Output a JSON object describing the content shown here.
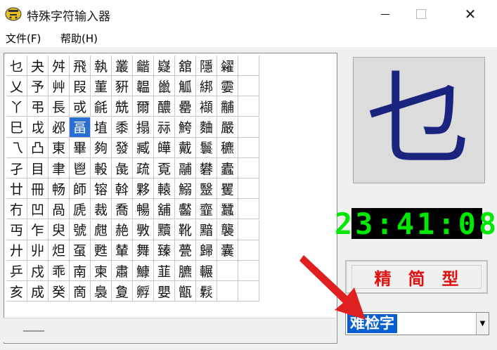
{
  "window": {
    "title": "特殊字符输入器",
    "icon": "app-icon",
    "minimize": "minimize-icon",
    "maximize": "maximize-icon",
    "close_glyph": "✕"
  },
  "menu": [
    "文件(F)",
    "帮助(H)"
  ],
  "grid": {
    "columns": 12,
    "rows": [
      [
        "乜",
        "夬",
        "舛",
        "飛",
        "執",
        "叢",
        "龤",
        "嶷",
        "舘",
        "隱",
        "糴",
        ""
      ],
      [
        "乂",
        "予",
        "艸",
        "叚",
        "菫",
        "豣",
        "韞",
        "巤",
        "觚",
        "綁",
        "孁",
        ""
      ],
      [
        "丫",
        "弔",
        "長",
        "戓",
        "毹",
        "兟",
        "爾",
        "醲",
        "罍",
        "襭",
        "黼",
        ""
      ],
      [
        "巳",
        "戉",
        "邲",
        "畐",
        "埴",
        "黍",
        "搨",
        "祘",
        "鮬",
        "麯",
        "嚴",
        ""
      ],
      [
        "乁",
        "凸",
        "東",
        "畢",
        "夠",
        "發",
        "臧",
        "皣",
        "戴",
        "鬟",
        "穮",
        ""
      ],
      [
        "孑",
        "目",
        "聿",
        "鬯",
        "軗",
        "彘",
        "疏",
        "覔",
        "鬴",
        "礬",
        "蠹",
        ""
      ],
      [
        "廿",
        "冊",
        "畅",
        "師",
        "镕",
        "斡",
        "夥",
        "轅",
        "鰯",
        "毉",
        "矍",
        ""
      ],
      [
        "冇",
        "凹",
        "咼",
        "虒",
        "裁",
        "喬",
        "暢",
        "舖",
        "齾",
        "韲",
        "蠶",
        ""
      ],
      [
        "丏",
        "乍",
        "臾",
        "號",
        "甝",
        "赩",
        "斆",
        "黷",
        "靴",
        "黯",
        "襲",
        ""
      ],
      [
        "廾",
        "丱",
        "炟",
        "虿",
        "甦",
        "輦",
        "舞",
        "臻",
        "甍",
        "歸",
        "囊",
        ""
      ],
      [
        "乒",
        "戍",
        "乖",
        "南",
        "柬",
        "肅",
        "鱇",
        "韮",
        "臕",
        "輾",
        "",
        ""
      ],
      [
        "亥",
        "成",
        "癸",
        "啇",
        "裊",
        "夐",
        "孵",
        "嬰",
        "甑",
        "鬏",
        "",
        ""
      ]
    ],
    "selected": "畐"
  },
  "preview_char": "乜",
  "clock": "23:41:08",
  "mode_label": "精简型",
  "combo_value": "难检字",
  "colors": {
    "selection": "#2a6fd6",
    "preview_char": "#1a237e",
    "clock": "#00e800",
    "mode_text": "#e01010",
    "arrow": "#e02020"
  }
}
